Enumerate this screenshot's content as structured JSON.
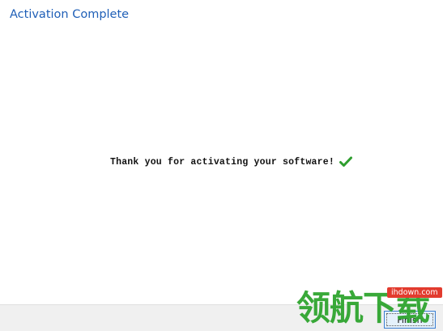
{
  "window": {
    "title": "Activation Complete"
  },
  "main": {
    "message": "Thank you for activating your software!",
    "status_icon": "checkmark-icon",
    "status_color": "#2e9e2e"
  },
  "footer": {
    "finish_label": "Finish"
  },
  "watermark": {
    "url": "ihdown.com",
    "text": "领航下载",
    "color": "#2fa52f",
    "badge_color": "#e23b2e"
  }
}
